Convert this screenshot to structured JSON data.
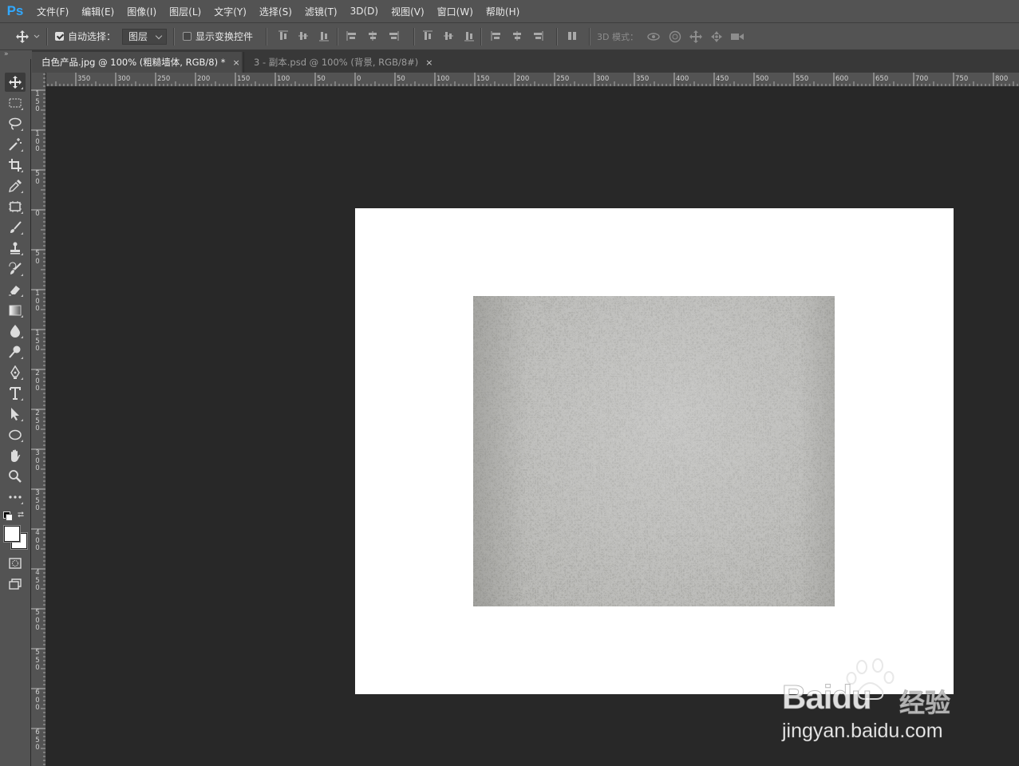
{
  "app": {
    "logo": "Ps"
  },
  "menu": [
    "文件(F)",
    "编辑(E)",
    "图像(I)",
    "图层(L)",
    "文字(Y)",
    "选择(S)",
    "滤镜(T)",
    "3D(D)",
    "视图(V)",
    "窗口(W)",
    "帮助(H)"
  ],
  "options": {
    "auto_select_label": "自动选择：",
    "auto_select_checked": true,
    "auto_select_target": "图层",
    "show_transform_label": "显示变换控件",
    "show_transform_checked": false,
    "mode_3d_label": "3D 模式："
  },
  "tabs": [
    {
      "label": "白色产品.jpg @ 100% (粗糙墙体, RGB/8) *",
      "close": "×",
      "active": true
    },
    {
      "label": "3 - 副本.psd @ 100% (背景, RGB/8#)",
      "close": "×",
      "active": false
    }
  ],
  "ruler": {
    "h_labels": [
      "350",
      "300",
      "250",
      "200",
      "150",
      "100",
      "50",
      "0",
      "50",
      "100",
      "150",
      "200",
      "250",
      "300",
      "350",
      "400",
      "450",
      "500",
      "550",
      "600",
      "650",
      "700",
      "750",
      "800"
    ],
    "v_labels": [
      "150",
      "100",
      "50",
      "0",
      "50",
      "100",
      "150",
      "200",
      "250",
      "300",
      "350",
      "400",
      "450",
      "500",
      "550",
      "600",
      "650"
    ]
  },
  "toolbar": {
    "tools": [
      "move-tool",
      "marquee-tool",
      "lasso-tool",
      "magic-wand-tool",
      "crop-tool",
      "eyedropper-tool",
      "frame-tool",
      "brush-tool",
      "stamp-tool",
      "history-brush-tool",
      "eraser-tool",
      "gradient-tool",
      "blur-tool",
      "dodge-tool",
      "pen-tool",
      "type-tool",
      "path-selection-tool",
      "ellipse-tool",
      "hand-tool",
      "zoom-tool",
      "more-tools"
    ],
    "foreground_color": "#ffffff",
    "background_color": "#ffffff"
  },
  "colors": {
    "accent": "#31a8ff",
    "canvas_bg": "#282828",
    "panel": "#535353"
  },
  "watermark": {
    "brand": "Bai",
    "brand_suffix": "du",
    "cn": "经验",
    "url": "jingyan.baidu.com"
  }
}
